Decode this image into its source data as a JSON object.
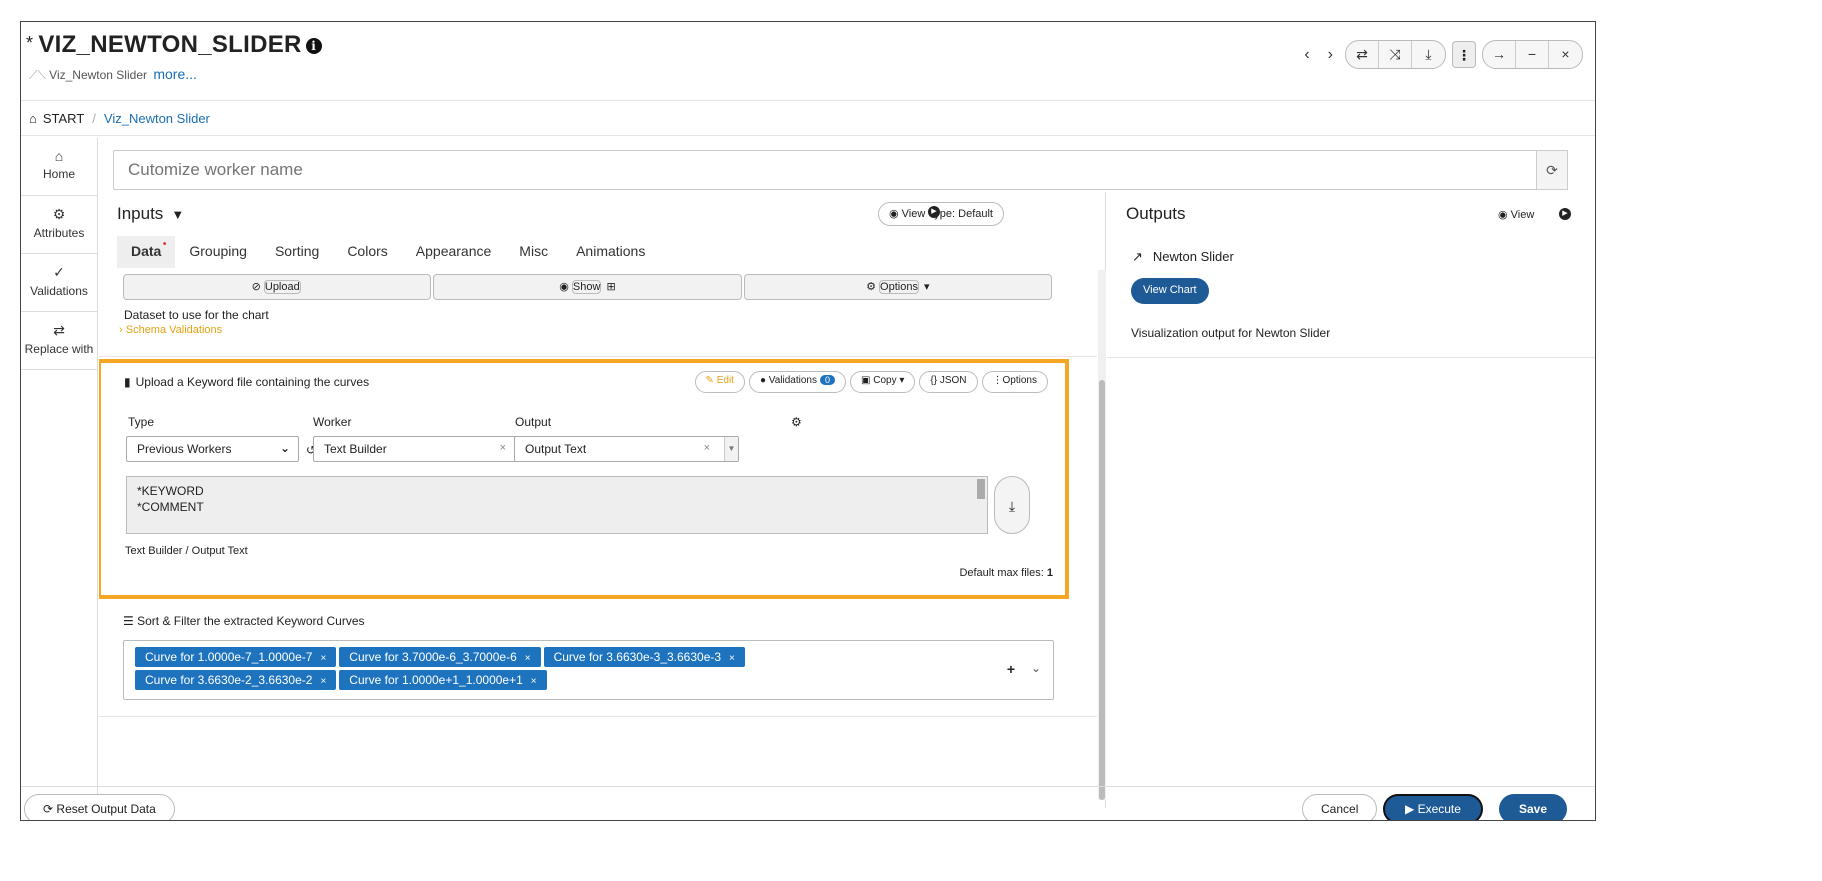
{
  "header": {
    "star": "*",
    "title": "VIZ_NEWTON_SLIDER",
    "subtitle": "Viz_Newton Slider",
    "more_link": "more..."
  },
  "breadcrumb": {
    "root": "START",
    "current": "Viz_Newton Slider"
  },
  "sidebar": {
    "items": [
      {
        "label": "Home",
        "icon": "home-icon"
      },
      {
        "label": "Attributes",
        "icon": "gear-icon"
      },
      {
        "label": "Validations",
        "icon": "checks-icon"
      },
      {
        "label": "Replace with",
        "icon": "swap-icon"
      }
    ]
  },
  "name_input": {
    "placeholder": "Cutomize worker name"
  },
  "inputs": {
    "title": "Inputs",
    "view_type": "View Type: Default",
    "tabs": [
      "Data",
      "Grouping",
      "Sorting",
      "Colors",
      "Appearance",
      "Misc",
      "Animations"
    ],
    "upload_bar": {
      "upload": "Upload",
      "show": "Show",
      "options": "Options"
    },
    "dataset_text": "Dataset to use for the chart",
    "schema_validations": "Schema Validations",
    "keyword_section": {
      "title": "Upload a Keyword file containing the curves",
      "edit": "Edit",
      "validations": "Validations",
      "validations_count": "0",
      "copy": "Copy",
      "json": "{} JSON",
      "options": "Options",
      "type_label": "Type",
      "worker_label": "Worker",
      "output_label": "Output",
      "type_value": "Previous Workers",
      "worker_value": "Text Builder",
      "output_value": "Output Text",
      "textarea_lines": [
        "*KEYWORD",
        "*COMMENT"
      ],
      "path": "Text Builder / Output Text",
      "max_files_label": "Default max files:",
      "max_files_value": "1"
    },
    "sort_filter": {
      "title": "Sort & Filter the extracted Keyword Curves",
      "chips": [
        "Curve for 1.0000e-7_1.0000e-7",
        "Curve for 3.7000e-6_3.7000e-6",
        "Curve for 3.6630e-3_3.6630e-3",
        "Curve for 3.6630e-2_3.6630e-2",
        "Curve for 1.0000e+1_1.0000e+1"
      ]
    }
  },
  "outputs": {
    "title": "Outputs",
    "view": "View",
    "item": "Newton Slider",
    "view_chart": "View Chart",
    "description": "Visualization output for Newton Slider"
  },
  "footer": {
    "reset": "Reset Output Data",
    "cancel": "Cancel",
    "execute": "Execute",
    "save": "Save"
  },
  "colors": {
    "accent": "#1e73be",
    "highlight": "#f5a623",
    "primary_button": "#1e5a96"
  }
}
